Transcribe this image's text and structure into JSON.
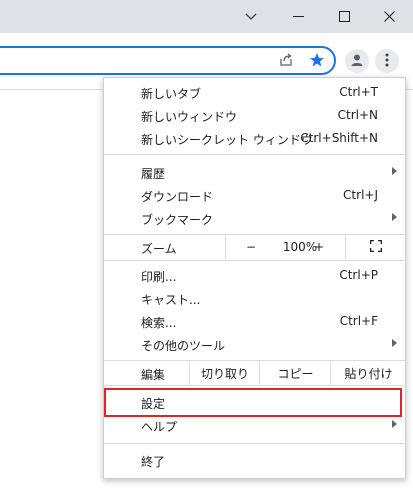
{
  "menu": {
    "new_tab": {
      "label": "新しいタブ",
      "shortcut": "Ctrl+T"
    },
    "new_window": {
      "label": "新しいウィンドウ",
      "shortcut": "Ctrl+N"
    },
    "new_incognito": {
      "label": "新しいシークレット ウィンドウ",
      "shortcut": "Ctrl+Shift+N"
    },
    "history": {
      "label": "履歴"
    },
    "downloads": {
      "label": "ダウンロード",
      "shortcut": "Ctrl+J"
    },
    "bookmarks": {
      "label": "ブックマーク"
    },
    "zoom": {
      "label": "ズーム",
      "minus": "−",
      "value": "100%",
      "plus": "+"
    },
    "print": {
      "label": "印刷...",
      "shortcut": "Ctrl+P"
    },
    "cast": {
      "label": "キャスト..."
    },
    "find": {
      "label": "検索...",
      "shortcut": "Ctrl+F"
    },
    "more_tools": {
      "label": "その他のツール"
    },
    "edit": {
      "label": "編集",
      "cut": "切り取り",
      "copy": "コピー",
      "paste": "貼り付け"
    },
    "settings": {
      "label": "設定"
    },
    "help": {
      "label": "ヘルプ"
    },
    "exit": {
      "label": "終了"
    }
  },
  "icons": {
    "minimize": "chevron-down-icon",
    "restore": "minimize-icon",
    "maximize": "maximize-icon",
    "close": "close-icon",
    "share": "share-icon",
    "bookmark": "star-icon",
    "profile": "profile-icon",
    "menu": "kebab-menu-icon",
    "fullscreen": "fullscreen-icon"
  },
  "colors": {
    "accent": "#1a73e8",
    "highlight_border": "#e0242b",
    "titlebar": "#dee1e6"
  }
}
